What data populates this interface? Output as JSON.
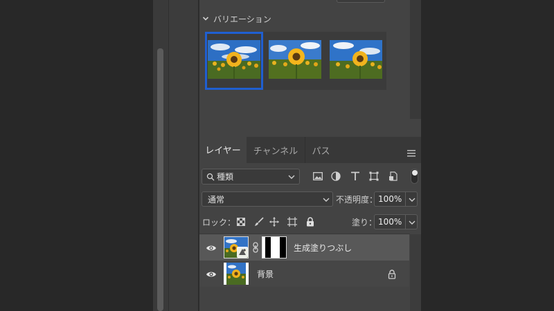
{
  "properties": {
    "variations_label": "バリエーション",
    "selected_variation": 1
  },
  "tabs": {
    "layers": "レイヤー",
    "channels": "チャンネル",
    "paths": "パス"
  },
  "filter": {
    "kind_label": "種類"
  },
  "blend": {
    "mode": "通常",
    "opacity_label": "不透明度：",
    "opacity_value": "100%"
  },
  "lock": {
    "label": "ロック：",
    "fill_label": "塗り：",
    "fill_value": "100%"
  },
  "layers": [
    {
      "name": "生成塗りつぶし",
      "selected": true,
      "visible": true,
      "locked": false
    },
    {
      "name": "背景",
      "selected": false,
      "visible": true,
      "locked": true
    }
  ],
  "colors": {
    "selection_blue": "#1f5fd1",
    "panel_bg": "#434343",
    "selected_row": "#585858"
  },
  "icons": {
    "filter": [
      "image-filter-icon",
      "adjustment-filter-icon",
      "type-filter-icon",
      "shape-filter-icon",
      "smart-object-filter-icon"
    ],
    "lock": [
      "lock-transparent-pixels-icon",
      "lock-image-pixels-icon",
      "lock-position-icon",
      "lock-artboard-icon",
      "lock-all-icon"
    ]
  }
}
